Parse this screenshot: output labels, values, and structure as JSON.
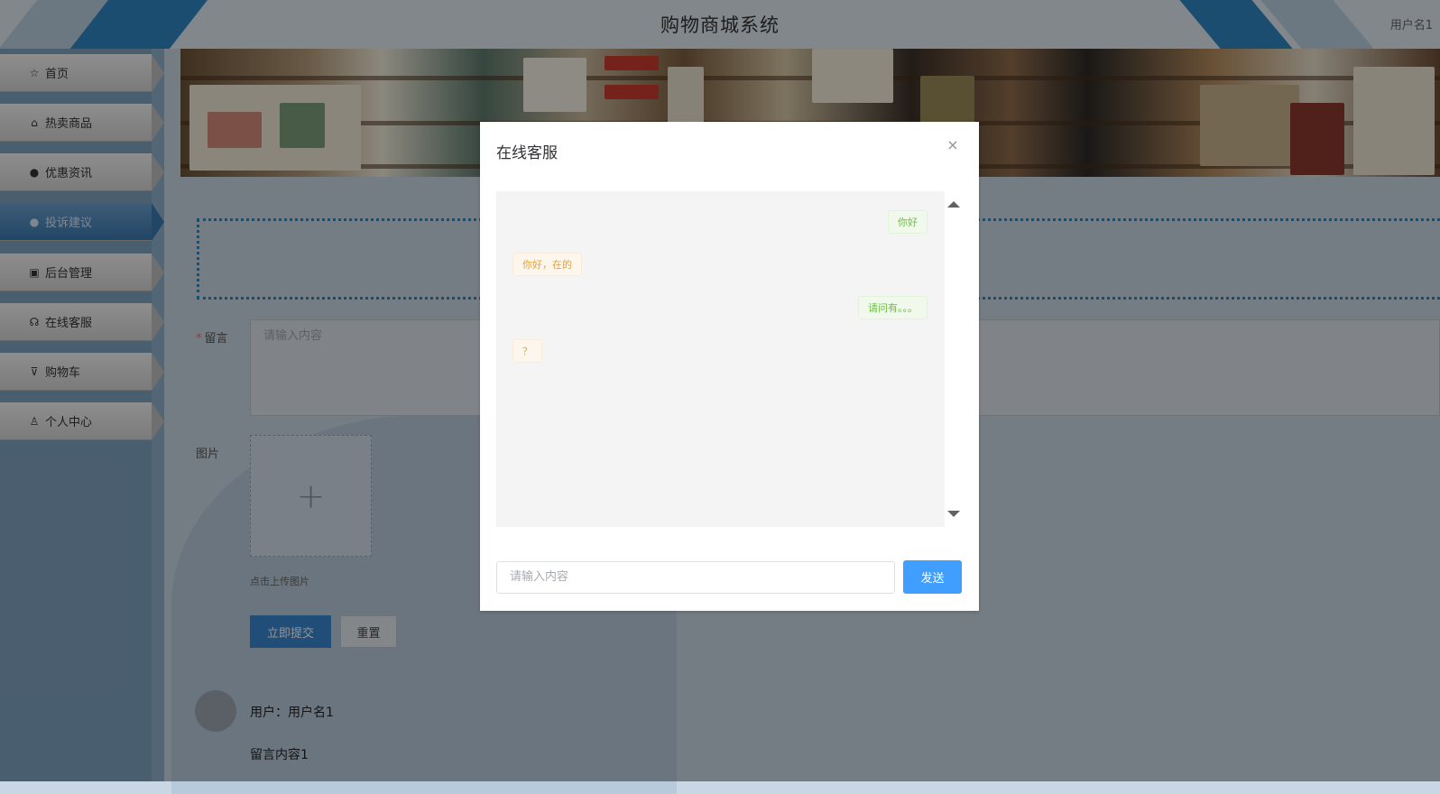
{
  "header": {
    "title": "购物商城系统",
    "username": "用户名1"
  },
  "sidebar": {
    "items": [
      {
        "label": "首页",
        "icon": "star-icon",
        "glyph": "☆"
      },
      {
        "label": "热卖商品",
        "icon": "bag-icon",
        "glyph": "⌂"
      },
      {
        "label": "优惠资讯",
        "icon": "info-icon",
        "glyph": "●"
      },
      {
        "label": "投诉建议",
        "icon": "question-icon",
        "glyph": "●"
      },
      {
        "label": "后台管理",
        "icon": "briefcase-icon",
        "glyph": "▣"
      },
      {
        "label": "在线客服",
        "icon": "headset-icon",
        "glyph": "☊"
      },
      {
        "label": "购物车",
        "icon": "cart-icon",
        "glyph": "⊽"
      },
      {
        "label": "个人中心",
        "icon": "user-icon",
        "glyph": "♙"
      }
    ],
    "active_index": 3
  },
  "form": {
    "message_label": "留言",
    "message_required": "*",
    "message_placeholder": "请输入内容",
    "image_label": "图片",
    "upload_glyph": "+",
    "upload_tip": "点击上传图片",
    "submit_label": "立即提交",
    "reset_label": "重置"
  },
  "comment": {
    "user_line": "用户：用户名1",
    "content": "留言内容1"
  },
  "dialog": {
    "title": "在线客服",
    "close_glyph": "×",
    "messages": [
      {
        "from": "me",
        "text": "你好"
      },
      {
        "from": "cs",
        "text": "你好，在的"
      },
      {
        "from": "me",
        "text": "请问有。。。"
      },
      {
        "from": "cs",
        "text": "？"
      }
    ],
    "input_placeholder": "请输入内容",
    "send_label": "发送"
  },
  "colors": {
    "primary": "#409eff",
    "submit": "#3a86d1",
    "accent_stripe": "#2d86c0",
    "required": "#f56c6c",
    "bubble_me_text": "#67c23a",
    "bubble_cs_text": "#e6a23c"
  }
}
